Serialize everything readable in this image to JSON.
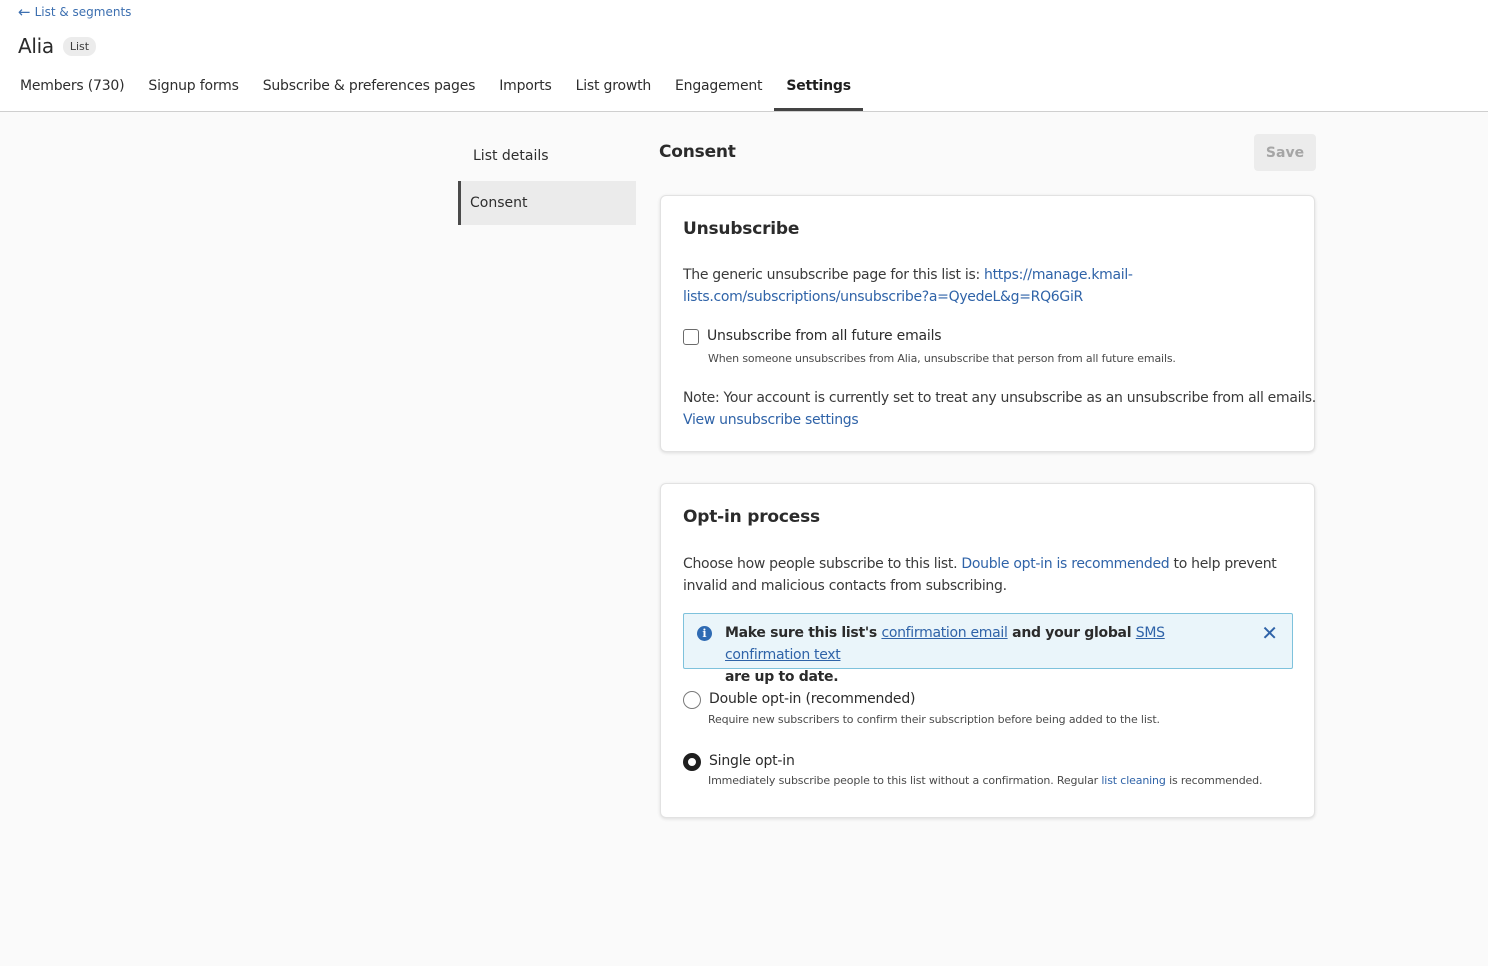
{
  "header": {
    "back_label": "List & segments",
    "title": "Alia",
    "badge": "List",
    "tabs": [
      {
        "label": "Members (730)"
      },
      {
        "label": "Signup forms"
      },
      {
        "label": "Subscribe & preferences pages"
      },
      {
        "label": "Imports"
      },
      {
        "label": "List growth"
      },
      {
        "label": "Engagement"
      },
      {
        "label": "Settings",
        "active": true
      }
    ]
  },
  "sidenav": {
    "items": [
      {
        "label": "List details"
      },
      {
        "label": "Consent",
        "active": true
      }
    ]
  },
  "main": {
    "title": "Consent",
    "save_label": "Save"
  },
  "unsubscribe": {
    "title": "Unsubscribe",
    "generic_text": "The generic unsubscribe page for this list is: ",
    "url_line1": "https://manage.kmail-",
    "url_line2": "lists.com/subscriptions/unsubscribe?a=QyedeL&g=RQ6GiR",
    "all_future_label": "Unsubscribe from all future emails",
    "all_future_checked": false,
    "all_future_help": "When someone unsubscribes from Alia, unsubscribe that person from all future emails.",
    "note": "Note: Your account is currently set to treat any unsubscribe as an unsubscribe from all emails.",
    "settings_link": "View unsubscribe settings"
  },
  "optin": {
    "title": "Opt-in process",
    "desc_pre": "Choose how people subscribe to this list. ",
    "desc_link": "Double opt-in is recommended",
    "desc_post": " to help prevent",
    "desc_line2": "invalid and malicious contacts from subscribing.",
    "info": {
      "pre": "Make sure this list's ",
      "link1": "confirmation email",
      "mid": " and your global ",
      "link2": "SMS confirmation text",
      "post": "are up to date.",
      "icon_glyph": "i",
      "close_glyph": "✕"
    },
    "double": {
      "label": "Double opt-in (recommended)",
      "help": "Require new subscribers to confirm their subscription before being added to the list.",
      "selected": false
    },
    "single": {
      "label": "Single opt-in",
      "help_pre": "Immediately subscribe people to this list without a confirmation. Regular ",
      "help_link": "list cleaning",
      "help_post": " is recommended.",
      "selected": true
    }
  }
}
